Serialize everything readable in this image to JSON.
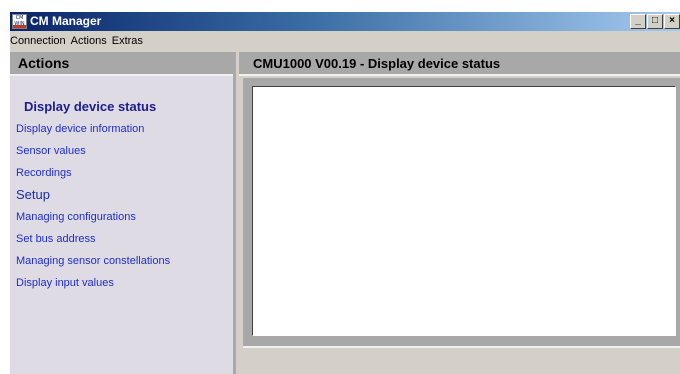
{
  "window": {
    "title": "CM Manager",
    "icon_text": "CM WIN",
    "buttons": {
      "minimize": "_",
      "maximize": "□",
      "close": "×"
    }
  },
  "menubar": {
    "items": [
      {
        "label": "Connection"
      },
      {
        "label": "Actions"
      },
      {
        "label": "Extras"
      }
    ]
  },
  "sidebar": {
    "header": "Actions",
    "items": [
      {
        "label": "Display device status",
        "state": "active"
      },
      {
        "label": "Display device information"
      },
      {
        "label": "Sensor values"
      },
      {
        "label": "Recordings"
      },
      {
        "label": "Setup",
        "kind": "section"
      },
      {
        "label": "Managing configurations"
      },
      {
        "label": "Set bus address"
      },
      {
        "label": "Managing sensor constellations"
      },
      {
        "label": "Display input values"
      }
    ]
  },
  "main": {
    "header": "CMU1000 V00.19 - Display device status"
  },
  "colors": {
    "link": "#1f2fbf",
    "panel_header": "#a8a8a8",
    "sidebar_bg": "#dedbe5",
    "titlebar_start": "#0a246a",
    "titlebar_end": "#a6caf0"
  }
}
